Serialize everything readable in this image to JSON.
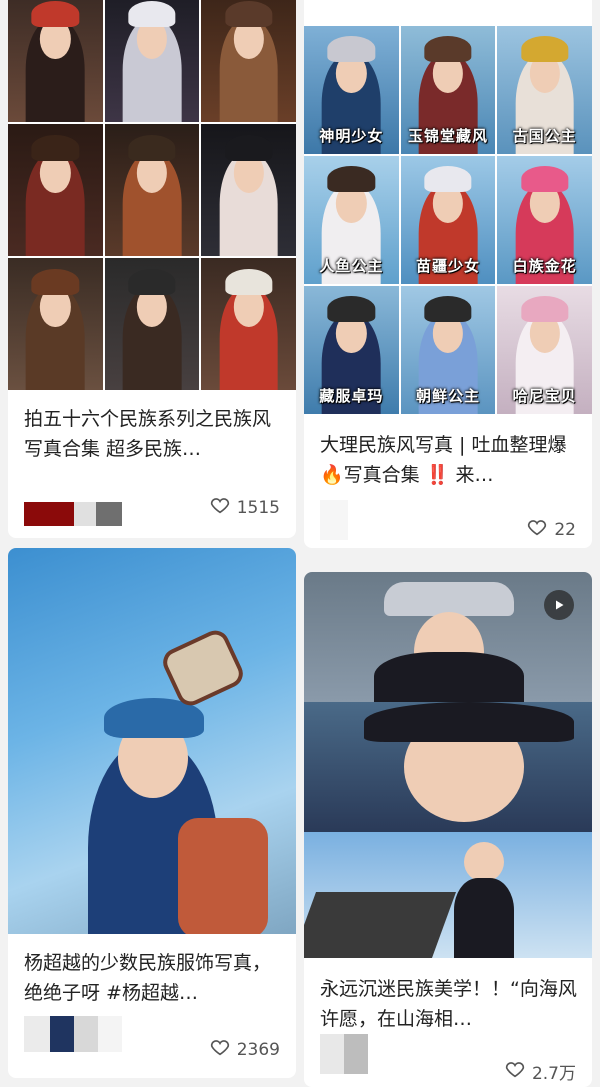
{
  "colors": {
    "background": "#f2f2f2",
    "card": "#ffffff",
    "text": "#222222",
    "meta": "#555555"
  },
  "cards": [
    {
      "title": "拍五十六个民族系列之民族风写真合集 超多民族…",
      "likes": "1515",
      "icon": "heart-icon"
    },
    {
      "title_part1": "大理民族风写真 | 吐血整理爆",
      "title_part2": "写真合集",
      "title_part3": "来…",
      "fire_emoji": "🔥",
      "bang_emoji": "‼️",
      "likes": "22",
      "icon": "heart-icon",
      "tile_captions": [
        "神明少女",
        "玉锦堂藏风",
        "古国公主",
        "人鱼公主",
        "苗疆少女",
        "白族金花",
        "藏服卓玛",
        "朝鲜公主",
        "哈尼宝贝"
      ]
    },
    {
      "title": "杨超越的少数民族服饰写真，绝绝子呀 #杨超越…",
      "likes": "2369",
      "icon": "heart-icon"
    },
    {
      "title": "永远沉迷民族美学！！“向海风许愿，在山海相…",
      "likes": "2.7万",
      "icon": "heart-icon",
      "badge_icon": "play-icon"
    }
  ]
}
